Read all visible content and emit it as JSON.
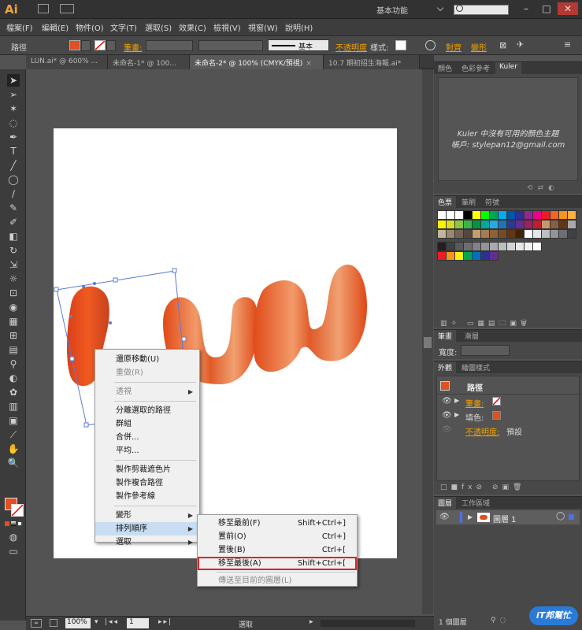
{
  "app": {
    "logo": "Ai",
    "workspace": "基本功能"
  },
  "menu": [
    "檔案(F)",
    "編輯(E)",
    "物件(O)",
    "文字(T)",
    "選取(S)",
    "效果(C)",
    "檢視(V)",
    "視窗(W)",
    "說明(H)"
  ],
  "control": {
    "object_type": "路徑",
    "stroke_label": "筆畫:",
    "brush_label": "基本",
    "opacity_label": "不透明度",
    "style_label": "樣式:",
    "align_label": "對齊",
    "transform_label": "變形"
  },
  "doc_tabs": [
    {
      "label": "LUN.ai* @ 600% ...",
      "active": false
    },
    {
      "label": "未命名-1* @ 100...",
      "active": false
    },
    {
      "label": "未命名-2* @ 100% (CMYK/預視)",
      "active": true
    },
    {
      "label": "10.7 期初招生海報.ai*",
      "active": false
    }
  ],
  "context_menu": {
    "items": [
      {
        "label": "還原移動(U)",
        "disabled": false,
        "submenu": false
      },
      {
        "label": "重做(R)",
        "disabled": true,
        "submenu": false
      },
      {
        "sep": true
      },
      {
        "label": "透視",
        "disabled": true,
        "submenu": true
      },
      {
        "sep": true
      },
      {
        "label": "分離選取的路徑",
        "disabled": false,
        "submenu": false
      },
      {
        "label": "群組",
        "disabled": false,
        "submenu": false
      },
      {
        "label": "合併...",
        "disabled": false,
        "submenu": false
      },
      {
        "label": "平均...",
        "disabled": false,
        "submenu": false
      },
      {
        "sep": true
      },
      {
        "label": "製作剪裁遮色片",
        "disabled": false,
        "submenu": false
      },
      {
        "label": "製作複合路徑",
        "disabled": false,
        "submenu": false
      },
      {
        "label": "製作參考線",
        "disabled": false,
        "submenu": false
      },
      {
        "sep": true
      },
      {
        "label": "變形",
        "disabled": false,
        "submenu": true
      },
      {
        "label": "排列順序",
        "disabled": false,
        "submenu": true,
        "highlight": true
      },
      {
        "label": "選取",
        "disabled": false,
        "submenu": true
      }
    ]
  },
  "submenu": {
    "items": [
      {
        "label": "移至最前(F)",
        "shortcut": "Shift+Ctrl+]",
        "disabled": false
      },
      {
        "label": "置前(O)",
        "shortcut": "Ctrl+]",
        "disabled": false
      },
      {
        "label": "置後(B)",
        "shortcut": "Ctrl+[",
        "disabled": false
      },
      {
        "label": "移至最後(A)",
        "shortcut": "Shift+Ctrl+[",
        "disabled": false,
        "boxed": true
      },
      {
        "sep": true
      },
      {
        "label": "傳送至目前的圖層(L)",
        "shortcut": "",
        "disabled": true
      }
    ]
  },
  "panels": {
    "color_tabs": [
      "顏色",
      "色彩參考",
      "Kuler"
    ],
    "kuler_message": "Kuler 中沒有可用的顏色主題",
    "kuler_account": "帳戶: stylepan12@gmail.com",
    "swatch_tabs": [
      "色票",
      "筆刷",
      "符號"
    ],
    "stroke_tabs": [
      "筆畫",
      "漸層"
    ],
    "stroke_weight_label": "寬度:",
    "appearance_tabs": [
      "外觀",
      "繪圖樣式"
    ],
    "appearance_title": "路徑",
    "appearance_rows": [
      "筆畫:",
      "填色:",
      "不透明度:"
    ],
    "appearance_opacity_value": "預設",
    "layers_tabs": [
      "圖層",
      "工作區域"
    ],
    "layer_name": "圖層 1",
    "layers_count": "1 個圖層"
  },
  "status": {
    "zoom": "100%",
    "artboard": "1",
    "mode": "選取"
  },
  "watermark": "iT邦幫忙",
  "colors": {
    "accent": "#f0a000",
    "shape": "#e04a17",
    "fill_swatch": "#e05020"
  }
}
